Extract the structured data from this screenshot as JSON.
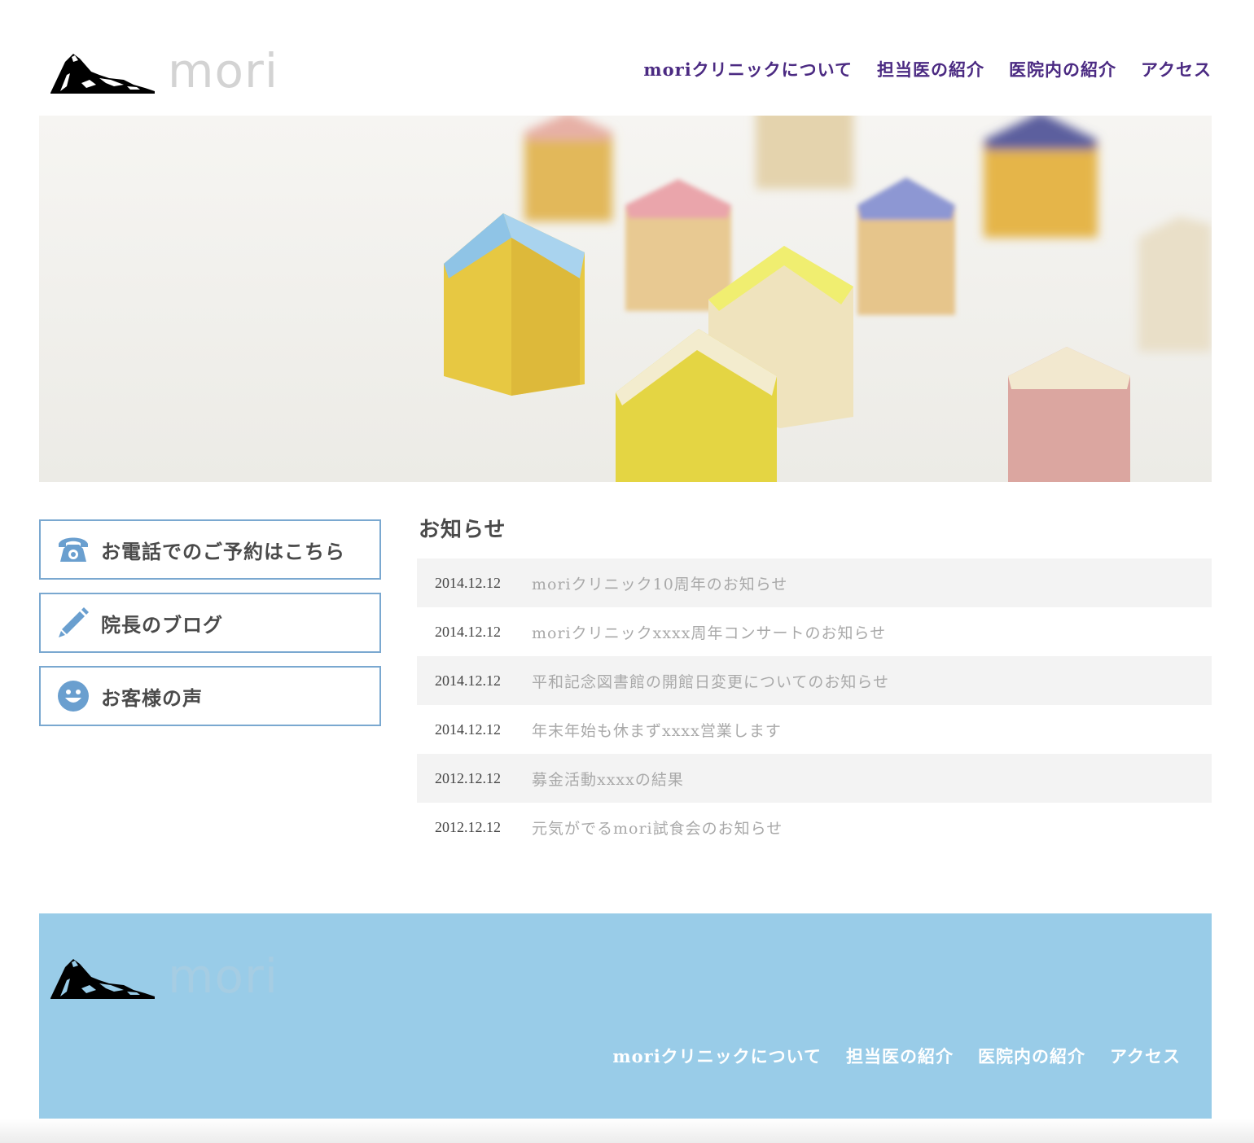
{
  "header": {
    "logo_text": "mori",
    "nav": [
      {
        "label": "moriクリニックについて"
      },
      {
        "label": "担当医の紹介"
      },
      {
        "label": "医院内の紹介"
      },
      {
        "label": "アクセス"
      }
    ]
  },
  "side": {
    "buttons": [
      {
        "label": "お電話でのご予約はこちら",
        "icon": "telephone-icon"
      },
      {
        "label": "院長のブログ",
        "icon": "pencil-icon"
      },
      {
        "label": "お客様の声",
        "icon": "smiley-face-icon"
      }
    ]
  },
  "news": {
    "title": "お知らせ",
    "items": [
      {
        "date": "2014.12.12",
        "text": "moriクリニック10周年のお知らせ"
      },
      {
        "date": "2014.12.12",
        "text": "moriクリニックxxxx周年コンサートのお知らせ"
      },
      {
        "date": "2014.12.12",
        "text": "平和記念図書館の開館日変更についてのお知らせ"
      },
      {
        "date": "2014.12.12",
        "text": "年末年始も休まずxxxx営業します"
      },
      {
        "date": "2012.12.12",
        "text": "募金活動xxxxの結果"
      },
      {
        "date": "2012.12.12",
        "text": "元気がでるmori試食会のお知らせ"
      }
    ]
  },
  "footer": {
    "logo_text": "mori",
    "nav": [
      {
        "label": "moriクリニックについて"
      },
      {
        "label": "担当医の紹介"
      },
      {
        "label": "医院内の紹介"
      },
      {
        "label": "アクセス"
      }
    ]
  },
  "colors": {
    "nav_text": "#4b2a82",
    "button_border": "#7aa8d0",
    "icon_blue": "#6a9fcf",
    "footer_bg": "#99cce8",
    "news_stripe": "#f3f3f3"
  }
}
